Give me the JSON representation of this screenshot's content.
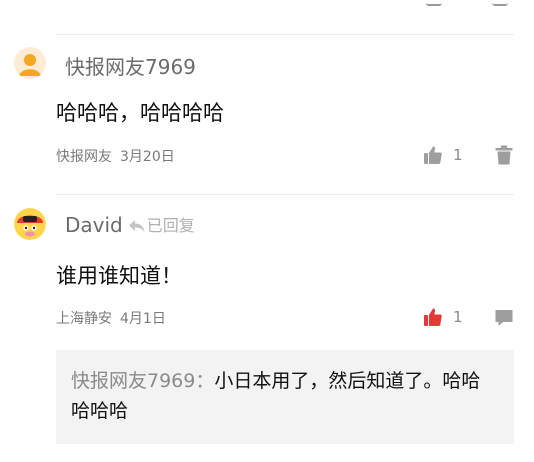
{
  "comments": [
    {
      "username": "快报网友7969",
      "text": "哈哈哈，哈哈哈哈",
      "location": "快报网友",
      "date": "3月20日",
      "likes": "1",
      "liked": false,
      "secondary_action_icon": "trash-icon"
    },
    {
      "username": "David",
      "replied_label": "已回复",
      "text": "谁用谁知道！",
      "location": "上海静安",
      "date": "4月1日",
      "likes": "1",
      "liked": true,
      "secondary_action_icon": "comment-icon",
      "quoted_reply": {
        "author": "快报网友7969",
        "separator": "：",
        "text": "小日本用了，然后知道了。哈哈哈哈哈"
      }
    }
  ],
  "colors": {
    "liked_red": "#e53935",
    "icon_gray": "#9e9e9e",
    "quote_bg": "#f3f3f3",
    "avatar_orange": "#f5a623"
  }
}
